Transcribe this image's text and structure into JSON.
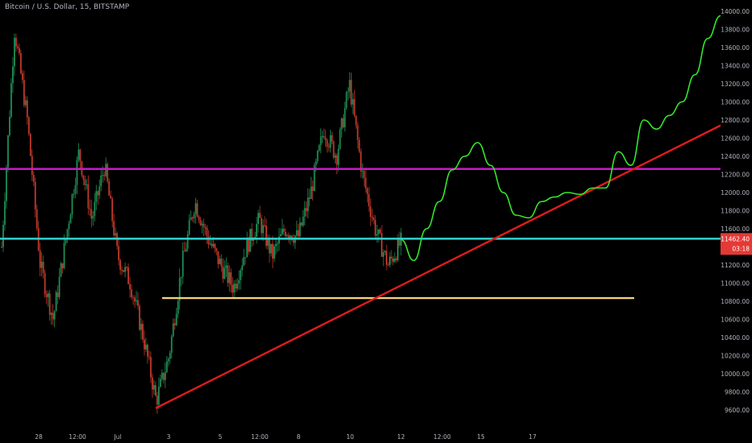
{
  "header": {
    "title": "Bitcoin / U.S. Dollar, 15, BITSTAMP"
  },
  "colors": {
    "background": "#000000",
    "axis_text": "#b2b5be",
    "candle_up": "#1e8f55",
    "candle_down": "#c0392b",
    "magenta_level": "#c71ac7",
    "cyan_level": "#2fd3cf",
    "yellow_level": "#f2d27a",
    "trendline": "#e11b1b",
    "projection": "#35e62c",
    "price_label_bg": "#e53935",
    "price_label_text": "#ffffff"
  },
  "price_label": {
    "price": "11462.40",
    "countdown": "03:18"
  },
  "chart_data": {
    "type": "line",
    "ylim": [
      9600,
      14000
    ],
    "y_ticks": [
      "14000.00",
      "13800.00",
      "13600.00",
      "13400.00",
      "13200.00",
      "13000.00",
      "12800.00",
      "12600.00",
      "12400.00",
      "12200.00",
      "12000.00",
      "11800.00",
      "11600.00",
      "11400.00",
      "11200.00",
      "11000.00",
      "10800.00",
      "10600.00",
      "10400.00",
      "10200.00",
      "10000.00",
      "9800.00",
      "9600.00"
    ],
    "x_ticks": [
      "28",
      "12:00",
      "Jul",
      "3",
      "5",
      "12:00",
      "8",
      "10",
      "12",
      "12:00",
      "15",
      "17"
    ],
    "grid": false,
    "horizontal_levels": [
      {
        "name": "magenta",
        "price": 12260
      },
      {
        "name": "cyan",
        "price": 11490
      },
      {
        "name": "yellow",
        "price": 10835
      }
    ],
    "trendline": {
      "from": {
        "x": "Jul",
        "price": 9620
      },
      "to": {
        "x": "past 17",
        "price": 12740
      }
    },
    "series": [
      {
        "kind": "price_path",
        "prices": [
          11400,
          13800,
          12800,
          11200,
          10600,
          11500,
          12450,
          11700,
          12300,
          11300,
          11000,
          10400,
          9700,
          10200,
          11200,
          11900,
          11500,
          11200,
          10950,
          11400,
          11700,
          11300,
          11600,
          11500,
          12000,
          12700,
          12400,
          13200,
          12200,
          11600,
          11200,
          11450
        ]
      },
      {
        "kind": "projection",
        "prices": [
          11480,
          11250,
          11600,
          11900,
          12250,
          12400,
          12550,
          12300,
          12000,
          11750,
          11720,
          11900,
          11950,
          12000,
          11980,
          12050,
          12050,
          12450,
          12300,
          12800,
          12700,
          12850,
          13000,
          13300,
          13700,
          13950
        ]
      }
    ]
  }
}
